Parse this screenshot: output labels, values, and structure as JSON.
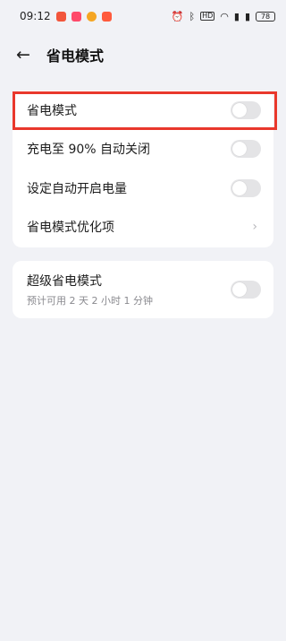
{
  "status_bar": {
    "time": "09:12",
    "battery": "78",
    "hd_label": "HD"
  },
  "header": {
    "title": "省电模式"
  },
  "settings": {
    "power_saving_mode": "省电模式",
    "charge_auto_off": "充电至 90% 自动关闭",
    "set_auto_on_level": "设定自动开启电量",
    "optimization_items": "省电模式优化项"
  },
  "super_saving": {
    "title": "超级省电模式",
    "estimate": "预计可用 2 天 2 小时 1 分钟"
  },
  "colors": {
    "highlight": "#e9382c",
    "toggle_off": "#e4e4e6",
    "background": "#f1f2f6"
  }
}
